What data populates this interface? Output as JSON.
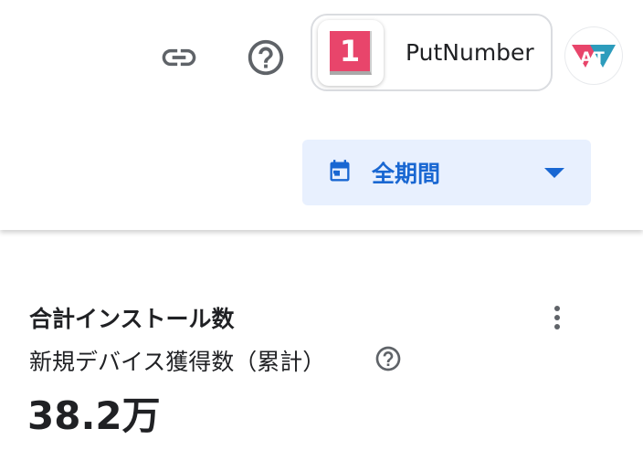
{
  "header": {
    "app": {
      "icon_label": "1",
      "name": "PutNumber"
    },
    "avatar": {
      "initials": "AT"
    },
    "icons": {
      "link": "link-icon",
      "help": "help-circle-icon"
    }
  },
  "date_range": {
    "label": "全期間"
  },
  "card": {
    "title": "合計インストール数",
    "metric_label": "新規デバイス獲得数（累計）",
    "metric_value": "38.2万"
  },
  "colors": {
    "accent": "#1967d2",
    "date_picker_bg": "#e8f0fe",
    "app_icon": "#e8456b",
    "avatar_red": "#e8456b",
    "avatar_teal": "#2d9cbc",
    "icon_gray": "#5f6368",
    "text": "#202124"
  }
}
